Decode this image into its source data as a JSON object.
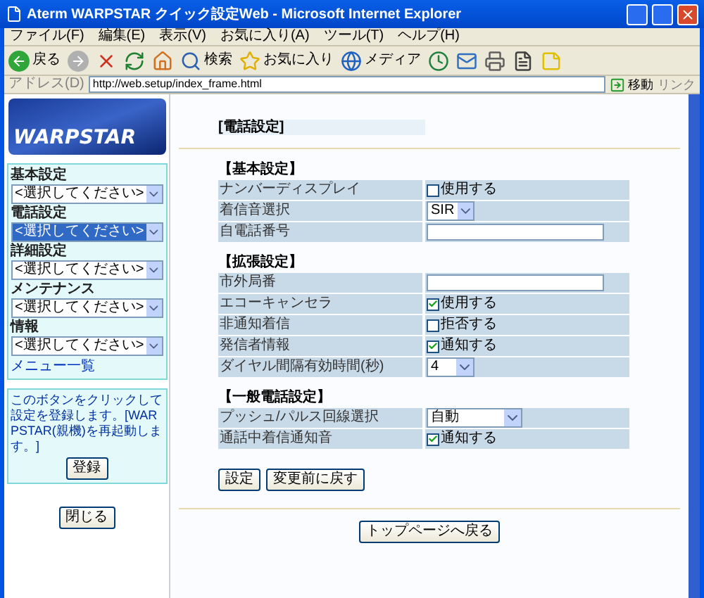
{
  "window": {
    "title": "Aterm WARPSTAR クイック設定Web - Microsoft Internet Explorer"
  },
  "menu": [
    "ファイル(F)",
    "編集(E)",
    "表示(V)",
    "お気に入り(A)",
    "ツール(T)",
    "ヘルプ(H)"
  ],
  "toolbar": [
    {
      "kind": "back",
      "label": "戻る"
    },
    {
      "kind": "forward"
    },
    {
      "kind": "stop"
    },
    {
      "kind": "refresh"
    },
    {
      "kind": "home"
    },
    {
      "kind": "search",
      "label": "検索"
    },
    {
      "kind": "favorites",
      "label": "お気に入り"
    },
    {
      "kind": "media",
      "label": "メディア"
    },
    {
      "kind": "history"
    },
    {
      "kind": "mail"
    },
    {
      "kind": "print"
    },
    {
      "kind": "edit"
    },
    {
      "kind": "note"
    }
  ],
  "address": {
    "label": "アドレス(D)",
    "value": "http://web.setup/index_frame.html",
    "go": "移動",
    "links": "リンク"
  },
  "sidebar": {
    "logo": "WARPSTAR",
    "menus": [
      {
        "label": "基本設定",
        "value": "<選択してください>",
        "selected": false
      },
      {
        "label": "電話設定",
        "value": "<選択してください>",
        "selected": true
      },
      {
        "label": "詳細設定",
        "value": "<選択してください>",
        "selected": false
      },
      {
        "label": "メンテナンス",
        "value": "<選択してください>",
        "selected": false
      },
      {
        "label": "情報",
        "value": "<選択してください>",
        "selected": false
      }
    ],
    "menu_list": "メニュー一覧",
    "note": "このボタンをクリックして設定を登録します。[WARPSTAR(親機)を再起動します。]",
    "register": "登録",
    "close": "閉じる"
  },
  "main": {
    "title": "[電話設定]",
    "sections": [
      {
        "title": "【基本設定】",
        "rows": [
          {
            "label": "ナンバーディスプレイ",
            "kind": "checkbox",
            "checked": false,
            "text": "使用する"
          },
          {
            "label": "着信音選択",
            "kind": "select",
            "value": "SIR"
          },
          {
            "label": "自電話番号",
            "kind": "text"
          }
        ]
      },
      {
        "title": "【拡張設定】",
        "rows": [
          {
            "label": "市外局番",
            "kind": "text"
          },
          {
            "label": "エコーキャンセラ",
            "kind": "checkbox",
            "checked": true,
            "text": "使用する"
          },
          {
            "label": "非通知着信",
            "kind": "checkbox",
            "checked": false,
            "text": "拒否する"
          },
          {
            "label": "発信者情報",
            "kind": "checkbox",
            "checked": true,
            "text": "通知する"
          },
          {
            "label": "ダイヤル間隔有効時間(秒)",
            "kind": "select",
            "value": "4"
          }
        ]
      },
      {
        "title": "【一般電話設定】",
        "rows": [
          {
            "label": "プッシュ/パルス回線選択",
            "kind": "select",
            "value": "自動"
          },
          {
            "label": "通話中着信通知音",
            "kind": "checkbox",
            "checked": true,
            "text": "通知する"
          }
        ]
      }
    ],
    "buttons": [
      "設定",
      "変更前に戻す"
    ],
    "top_button": "トップページへ戻る"
  }
}
